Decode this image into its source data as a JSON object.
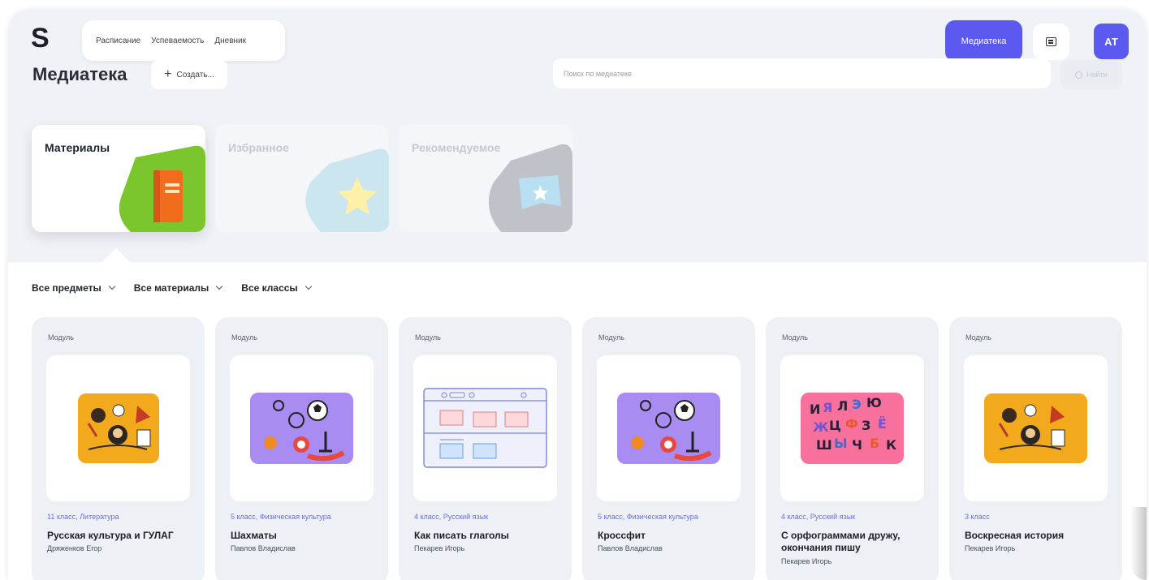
{
  "header": {
    "logo": "S",
    "nav": [
      "Расписание",
      "Успеваемость",
      "Дневник"
    ],
    "media_button": "Медиатека",
    "avatar": "АТ"
  },
  "page": {
    "title": "Медиатека",
    "create_label": "Создать...",
    "search_placeholder": "Поиск по медиатеке",
    "find_label": "Найти"
  },
  "categories": [
    "Материалы",
    "Избранное",
    "Рекомендуемое"
  ],
  "filters": [
    "Все предметы",
    "Все материалы",
    "Все классы"
  ],
  "cards": [
    {
      "type": "Модуль",
      "meta": "11 класс, Литература",
      "title": "Русская культура и ГУЛАГ",
      "author": "Дряженков Егор",
      "thumb": "literature-illustration"
    },
    {
      "type": "Модуль",
      "meta": "5 класс, Физическая культура",
      "title": "Шахматы",
      "author": "Павлов Владислав",
      "thumb": "sports-illustration"
    },
    {
      "type": "Модуль",
      "meta": "4 класс, Русский язык",
      "title": "Как писать глаголы",
      "author": "Пекарев Игорь",
      "thumb": "layout-wireframe-illustration"
    },
    {
      "type": "Модуль",
      "meta": "5 класс, Физическая культура",
      "title": "Кроссфит",
      "author": "Павлов Владислав",
      "thumb": "sports-illustration"
    },
    {
      "type": "Модуль",
      "meta": "4 класс, Русский язык",
      "title": "С орфограммами дружу, окончания пишу",
      "author": "Пекарев Игорь",
      "thumb": "alphabet-illustration"
    },
    {
      "type": "Модуль",
      "meta": "3 класс",
      "title": "Воскресная история",
      "author": "Пекарев Игорь",
      "thumb": "literature-illustration"
    }
  ],
  "colors": {
    "accent": "#5b59f0",
    "meta_text": "#6a6cf0",
    "top_background": "#eff2f6",
    "card_background": "#edf1f6"
  }
}
